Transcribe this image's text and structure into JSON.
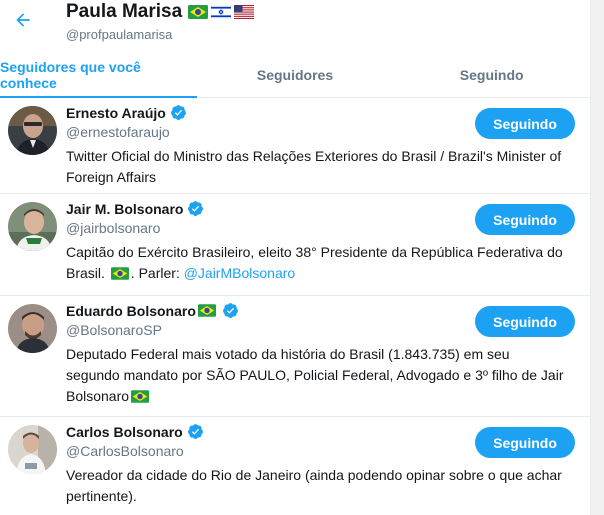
{
  "profile": {
    "name": "Paula Marisa",
    "handle": "@profpaulamarisa",
    "flags": [
      "flag-brazil",
      "flag-israel",
      "flag-usa"
    ]
  },
  "tabs": [
    {
      "label": "Seguidores que você conhece",
      "active": true
    },
    {
      "label": "Seguidores",
      "active": false
    },
    {
      "label": "Seguindo",
      "active": false
    }
  ],
  "users": [
    {
      "name": "Ernesto Araújo",
      "handle": "@ernestofaraujo",
      "button": "Seguindo",
      "bio": "Twitter Oficial do Ministro das Relações Exteriores do Brasil / Brazil's Minister of Foreign Affairs"
    },
    {
      "name": "Jair M. Bolsonaro",
      "handle": "@jairbolsonaro",
      "button": "Seguindo",
      "bio_before": "Capitão do Exército Brasileiro, eleito 38° Presidente da República Federativa do Brasil.",
      "bio_after": ". Parler:",
      "bio_link": "@JairMBolsonaro"
    },
    {
      "name": "Eduardo Bolsonaro",
      "handle": "@BolsonaroSP",
      "button": "Seguindo",
      "bio": "Deputado Federal mais votado da história do Brasil (1.843.735) em seu segundo mandato por SÃO PAULO, Policial Federal, Advogado e 3º filho de Jair Bolsonaro"
    },
    {
      "name": "Carlos Bolsonaro",
      "handle": "@CarlosBolsonaro",
      "button": "Seguindo",
      "bio": "Vereador da cidade do Rio de Janeiro (ainda podendo opinar sobre o que achar pertinente)."
    }
  ],
  "colors": {
    "accent": "#1da1f2",
    "text": "#14171a",
    "secondary": "#657786",
    "border": "#e6ecf0"
  }
}
